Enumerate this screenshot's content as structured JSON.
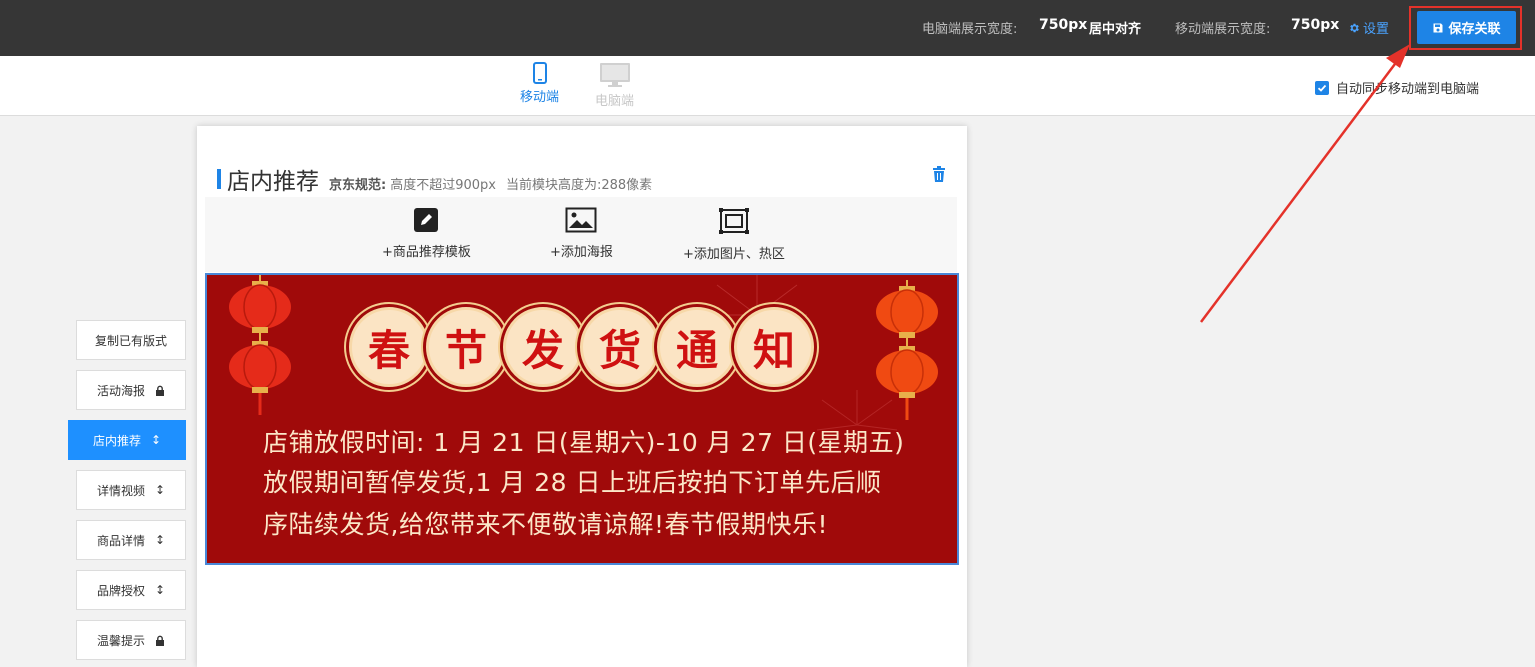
{
  "topbar": {
    "pc_width_label": "电脑端展示宽度:",
    "pc_width_value": "750px",
    "pc_align": "居中对齐",
    "mobile_width_label": "移动端展示宽度:",
    "mobile_width_value": "750px",
    "settings_label": "设置",
    "save_label": "保存关联"
  },
  "devices": {
    "mobile_label": "移动端",
    "pc_label": "电脑端"
  },
  "sync": {
    "label": "自动同步移动端到电脑端",
    "checked": true
  },
  "menu": {
    "items": [
      {
        "label": "复制已有版式",
        "icon": ""
      },
      {
        "label": "活动海报",
        "icon": "lock-icon"
      },
      {
        "label": "店内推荐",
        "icon": "move-vertical-icon"
      },
      {
        "label": "详情视频",
        "icon": "move-vertical-icon"
      },
      {
        "label": "商品详情",
        "icon": "move-vertical-icon"
      },
      {
        "label": "品牌授权",
        "icon": "move-vertical-icon"
      },
      {
        "label": "温馨提示",
        "icon": "lock-icon"
      }
    ],
    "active_index": 2
  },
  "module": {
    "title": "店内推荐",
    "spec_label": "京东规范:",
    "spec_text": "高度不超过900px",
    "current_height": "当前模块高度为:288像素"
  },
  "tools": {
    "template_label": "+商品推荐模板",
    "poster_label": "+添加海报",
    "image_label": "+添加图片、热区"
  },
  "banner": {
    "title_chars": [
      "春",
      "节",
      "发",
      "货",
      "通",
      "知"
    ],
    "line1": "店铺放假时间: 1 月 21 日(星期六)-10 月 27 日(星期五)",
    "line2": "放假期间暂停发货,1 月 28 日上班后按拍下订单先后顺",
    "line3": "序陆续发货,给您带来不便敬请谅解!春节假期快乐!",
    "bg_color": "#a00a0a",
    "text_color": "#fbe7c8",
    "title_color": "#cf1111"
  },
  "colors": {
    "accent": "#1e84e6",
    "highlight": "#e4322a",
    "topbar": "#363636"
  }
}
